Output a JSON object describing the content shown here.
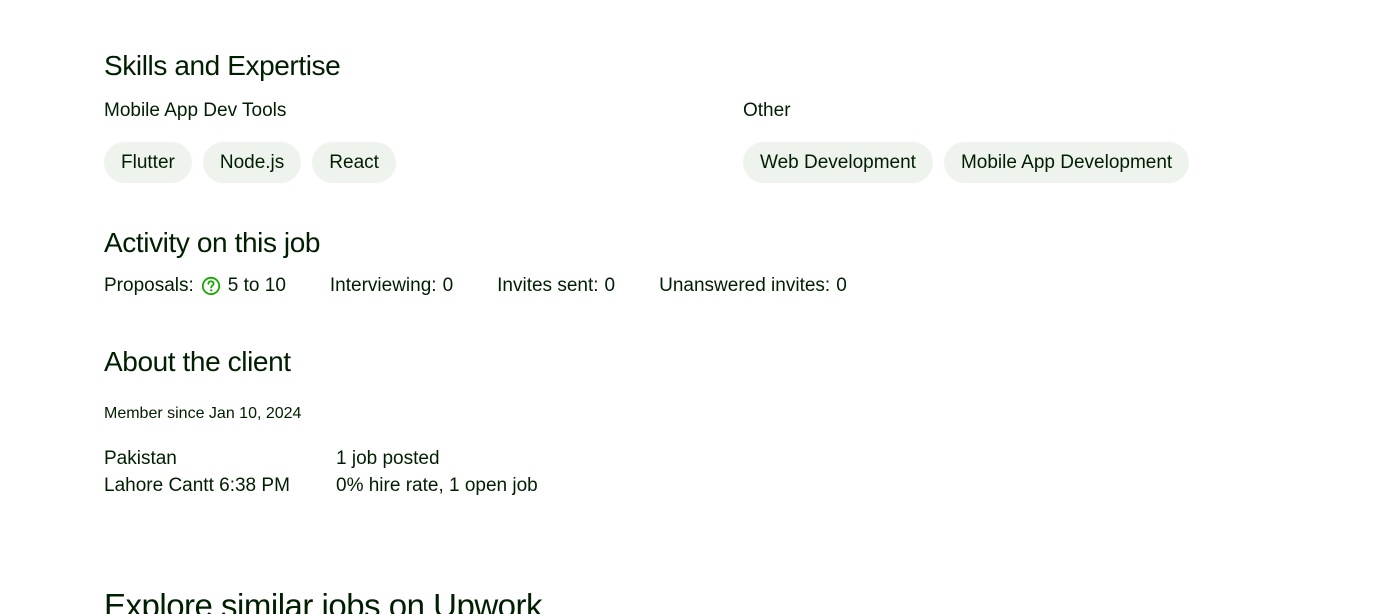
{
  "skills": {
    "title": "Skills and Expertise",
    "groups": [
      {
        "label": "Mobile App Dev Tools",
        "chips": [
          "Flutter",
          "Node.js",
          "React"
        ]
      },
      {
        "label": "Other",
        "chips": [
          "Web Development",
          "Mobile App Development"
        ]
      }
    ]
  },
  "activity": {
    "title": "Activity on this job",
    "proposals_label": "Proposals:",
    "proposals_value": "5 to 10",
    "interviewing_label": "Interviewing:",
    "interviewing_value": "0",
    "invites_label": "Invites sent:",
    "invites_value": "0",
    "unanswered_label": "Unanswered invites:",
    "unanswered_value": "0",
    "help_icon": "question-circle-icon",
    "accent_color": "#14a800"
  },
  "client": {
    "title": "About the client",
    "member_since": "Member since Jan 10, 2024",
    "country": "Pakistan",
    "location_time": "Lahore Cantt 6:38 PM",
    "jobs_posted": "1 job posted",
    "hire_rate": "0% hire rate, 1 open job"
  },
  "explore": {
    "title": "Explore similar jobs on Upwork"
  }
}
